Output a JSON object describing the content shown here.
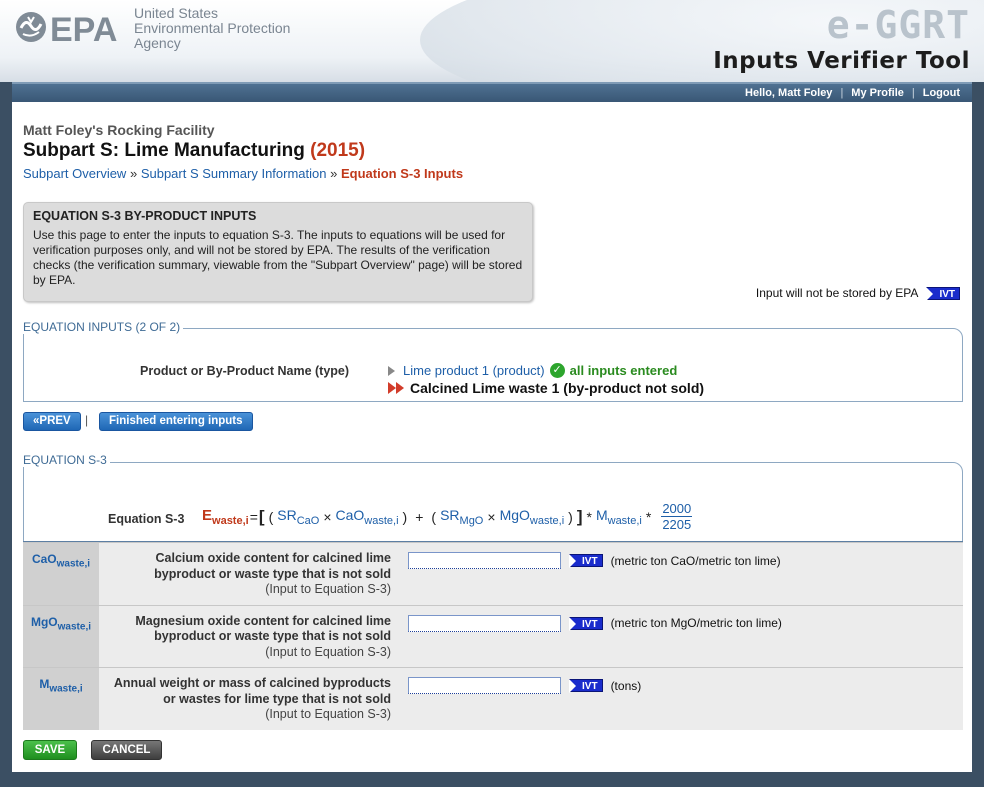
{
  "header": {
    "agency_lines": [
      "United States",
      "Environmental Protection",
      "Agency"
    ],
    "logo_text": "EPA",
    "app_name": "e-GGRT",
    "tool_name": "Inputs Verifier Tool"
  },
  "nav": {
    "greeting": "Hello, Matt Foley",
    "sep": "|",
    "my_profile": "My Profile",
    "logout": "Logout"
  },
  "page": {
    "facility": "Matt Foley's Rocking Facility",
    "subpart_title": "Subpart S: Lime Manufacturing",
    "year": "(2015)",
    "breadcrumb": {
      "overview": "Subpart Overview",
      "sep": "»",
      "summary": "Subpart S Summary Information",
      "current": "Equation S-3 Inputs"
    }
  },
  "info_box": {
    "title": "EQUATION S-3 BY-PRODUCT INPUTS",
    "text": "Use this page to enter the inputs to equation S-3. The inputs to equations will be used for verification purposes only, and will not be stored by EPA. The results of the verification checks (the verification summary, viewable from the \"Subpart Overview\" page) will be stored by EPA."
  },
  "ivt_legend": {
    "text": "Input will not be stored by EPA",
    "badge": "IVT"
  },
  "equation_inputs": {
    "section_label": "EQUATION INPUTS (2 OF 2)",
    "product_label": "Product or By-Product Name (type)",
    "products": [
      {
        "name": "Lime product 1 (product)",
        "status": "all inputs entered"
      },
      {
        "name": "Calcined Lime waste 1 (by-product not sold)"
      }
    ]
  },
  "buttons": {
    "prev": "PREV",
    "prev_arrow": "«",
    "pipe": "|",
    "finished": "Finished entering inputs",
    "save": "SAVE",
    "cancel": "CANCEL"
  },
  "equation": {
    "section_label": "EQUATION S-3",
    "label": "Equation S-3",
    "lhs_var": "E",
    "lhs_sub": "waste,i",
    "equals": "=",
    "open_bracket": "[",
    "close_bracket": "]",
    "open_paren": "(",
    "close_paren": ")",
    "times": "×",
    "plus": "+",
    "star": "*",
    "sr1": "SR",
    "sr1_sub": "CaO",
    "t1": "CaO",
    "t1_sub": "waste,i",
    "sr2": "SR",
    "sr2_sub": "MgO",
    "t2": "MgO",
    "t2_sub": "waste,i",
    "m": "M",
    "m_sub": "waste,i",
    "frac_num": "2000",
    "frac_den": "2205"
  },
  "inputs": [
    {
      "var": "CaO",
      "var_sub": "waste,i",
      "desc": "Calcium oxide content for calcined lime byproduct or waste type that is not sold",
      "note": "(Input to Equation S-3)",
      "value": "",
      "badge": "IVT",
      "unit": "(metric ton CaO/metric ton lime)"
    },
    {
      "var": "MgO",
      "var_sub": "waste,i",
      "desc": "Magnesium oxide content for calcined lime byproduct or waste type that is not sold",
      "note": "(Input to Equation S-3)",
      "value": "",
      "badge": "IVT",
      "unit": "(metric ton MgO/metric ton lime)"
    },
    {
      "var": "M",
      "var_sub": "waste,i",
      "desc": "Annual weight or mass of calcined byproducts or wastes for lime type that is not sold",
      "note": "(Input to Equation S-3)",
      "value": "",
      "badge": "IVT",
      "unit": "(tons)"
    }
  ],
  "colors": {
    "accent_blue": "#1e5fa8",
    "highlight_red": "#c0391b",
    "success_green": "#2a8b1f"
  }
}
